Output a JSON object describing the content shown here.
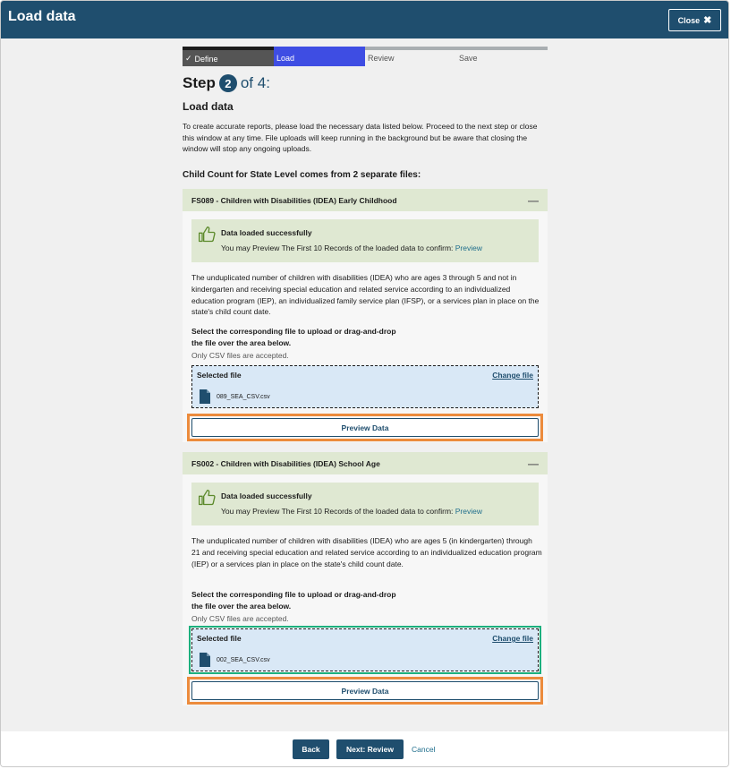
{
  "header": {
    "title": "Load data",
    "close_label": "Close"
  },
  "stepper": {
    "steps": [
      {
        "label": "Define",
        "state": "done"
      },
      {
        "label": "Load",
        "state": "current"
      },
      {
        "label": "Review",
        "state": "upcoming"
      },
      {
        "label": "Save",
        "state": "upcoming"
      }
    ]
  },
  "step_heading": {
    "word": "Step",
    "number": "2",
    "suffix": "of 4:"
  },
  "section_title": "Load data",
  "intro": "To create accurate reports, please load the necessary data listed below. Proceed to the next step or close this window at any time. File uploads will keep running in the background but be aware that closing the window will stop any ongoing uploads.",
  "count_title": "Child Count for State Level comes from 2 separate files:",
  "cards": [
    {
      "title": "FS089 - Children with Disabilities (IDEA) Early Childhood",
      "success_title": "Data loaded successfully",
      "success_text": "You may Preview The First 10 Records of the loaded data to confirm:",
      "preview_link": "Preview",
      "description": "The unduplicated number of children with disabilities (IDEA) who are ages 3 through 5 and not in kindergarten and receiving special education and related service according to an individualized education program (IEP), an individualized family service plan (IFSP), or a services plan in place on the state's child count date.",
      "select_label": "Select the corresponding file to upload or drag-and-drop the file over the area below.",
      "csv_note": "Only CSV files are accepted.",
      "selected_file_label": "Selected file",
      "change_file_label": "Change file",
      "file_name": "089_SEA_CSV.csv",
      "preview_button": "Preview Data"
    },
    {
      "title": "FS002 - Children with Disabilities (IDEA) School Age",
      "success_title": "Data loaded successfully",
      "success_text": "You may Preview The First 10 Records of the loaded data to confirm:",
      "preview_link": "Preview",
      "description": "The unduplicated number of children with disabilities (IDEA) who are ages 5 (in kindergarten) through 21 and receiving special education and related service according to an individualized education program (IEP) or a services plan in place on the state's child count date.",
      "select_label": "Select the corresponding file to upload or drag-and-drop the file over the area below.",
      "csv_note": "Only CSV files are accepted.",
      "selected_file_label": "Selected file",
      "change_file_label": "Change file",
      "file_name": "002_SEA_CSV.csv",
      "preview_button": "Preview Data"
    }
  ],
  "footer": {
    "back_label": "Back",
    "next_label": "Next: Review",
    "cancel_label": "Cancel"
  },
  "colors": {
    "header": "#1f4e6e",
    "accent": "#3e4de3",
    "success_bg": "#dfe8d2",
    "highlight": "#ec8b3c",
    "focus": "#1cb07e"
  }
}
